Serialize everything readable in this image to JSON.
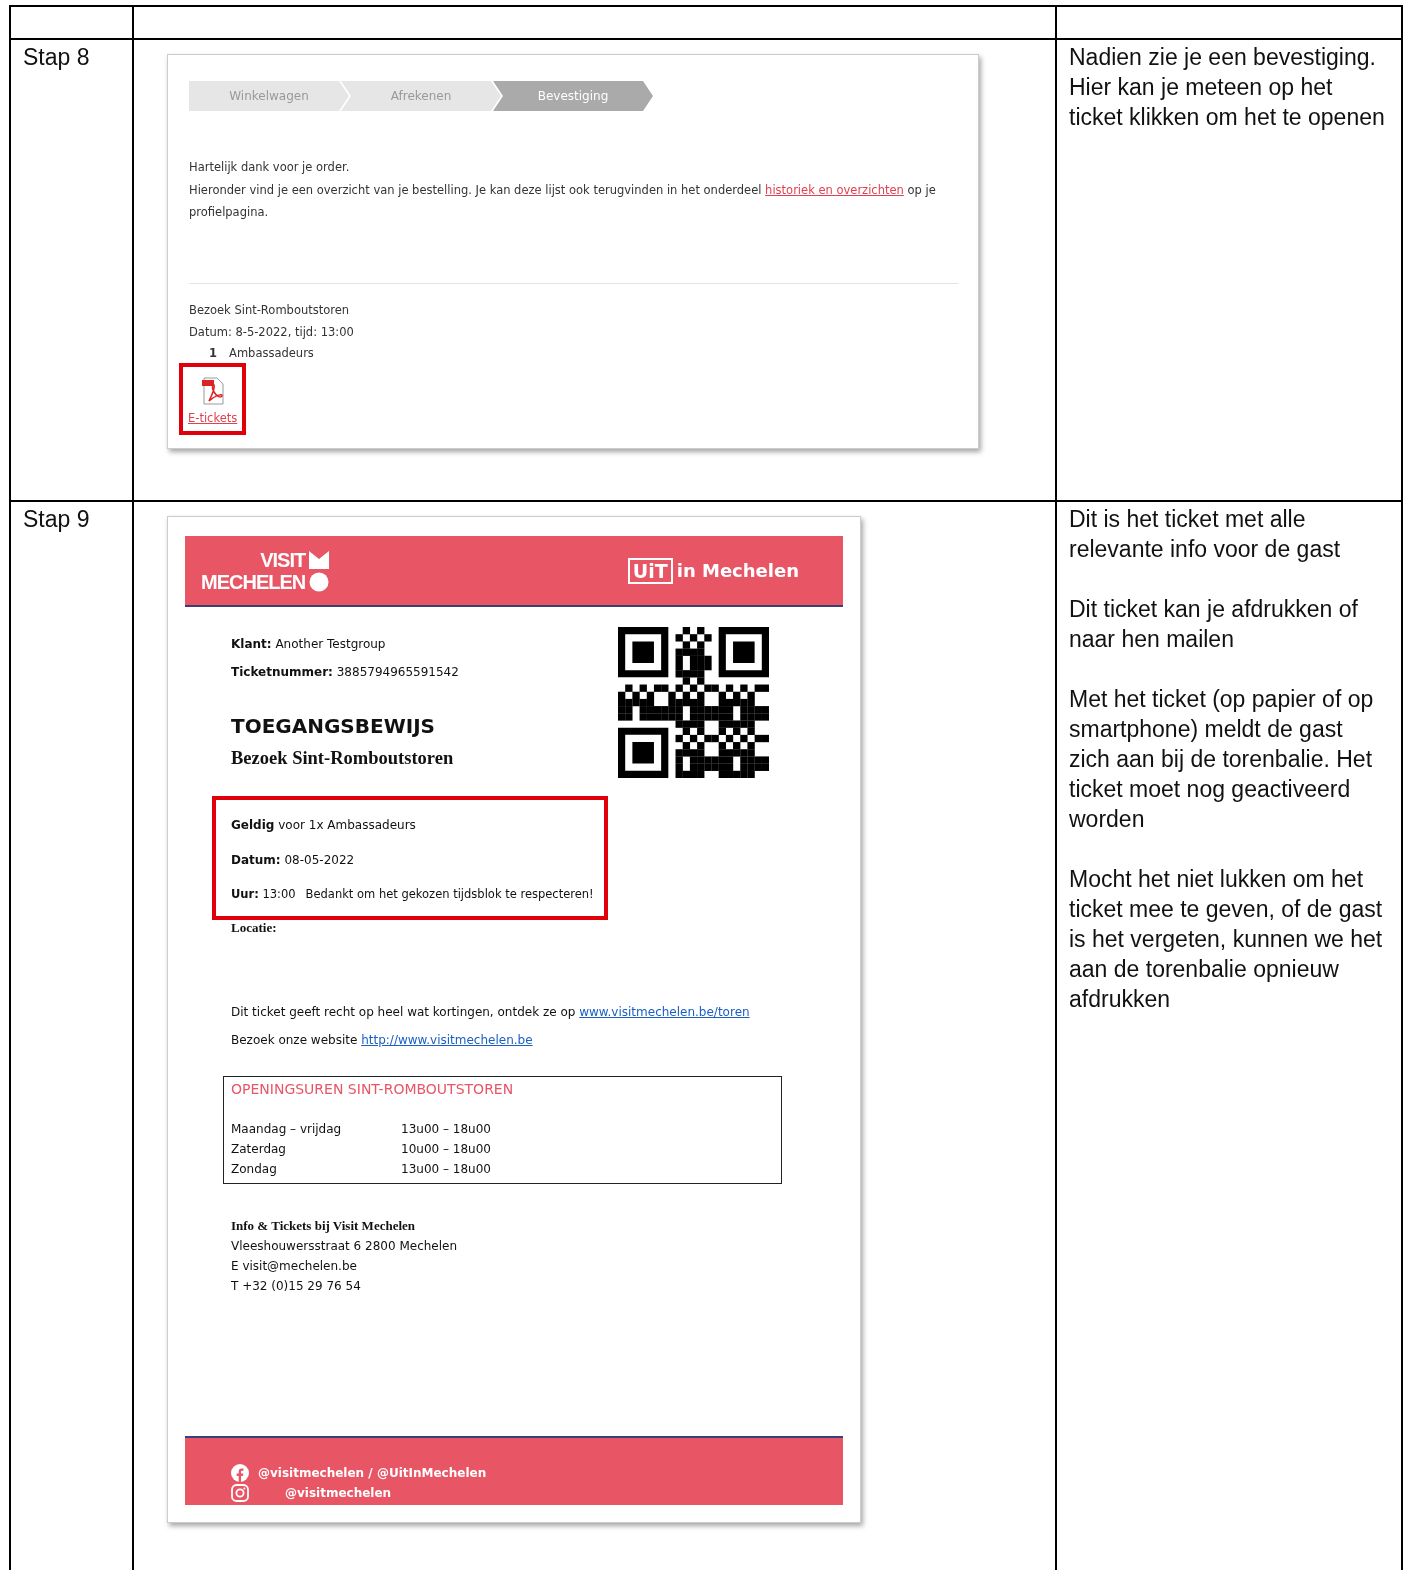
{
  "steps": [
    {
      "label": "Stap 8",
      "kind": "confirmation",
      "notes": [
        "Nadien zie je een bevestiging. Hier kan je meteen op het ticket klikken om het te openen"
      ]
    },
    {
      "label": "Stap 9",
      "kind": "ticket",
      "notes": [
        "Dit is het ticket met alle relevante info voor de gast",
        "Dit ticket kan je afdrukken of naar hen mailen",
        "Met het ticket (op papier of op smartphone) meldt de gast zich aan bij de torenbalie. Het ticket moet nog geactiveerd worden",
        "Mocht het niet lukken om het ticket mee te geven, of de gast is het vergeten, kunnen we het aan de torenbalie opnieuw afdrukken"
      ]
    }
  ],
  "confirmation": {
    "breadcrumbs": [
      {
        "label": "Winkelwagen",
        "selected": false
      },
      {
        "label": "Afrekenen",
        "selected": false
      },
      {
        "label": "Bevestiging",
        "selected": true
      }
    ],
    "thanks": "Hartelijk dank voor je order.",
    "intro_before": "Hieronder vind je een overzicht van je bestelling. Je kan deze lijst ook terugvinden in het onderdeel ",
    "intro_link": "historiek en overzichten",
    "intro_after": " op je profielpagina.",
    "order_title": "Bezoek Sint-Romboutstoren",
    "order_date": "Datum: 8-5-2022, tijd: 13:00",
    "quantity": "1",
    "ticket_type": "Ambassadeurs",
    "download": {
      "label": "E-tickets",
      "highlighted": true
    }
  },
  "ticket": {
    "logo_left": [
      "VISIT",
      "MECHELEN"
    ],
    "logo_right": {
      "badge": "UiT",
      "text": "in Mechelen"
    },
    "customer": "**Klant:**  Another Testgroup",
    "ticket_number": "**Ticketnummer:** 3885794965591542",
    "heading": "TOEGANGSBEWIJS",
    "subtitle": "Bezoek Sint-Romboutstoren",
    "details": {
      "highlighted": true,
      "valid": "**Geldig** voor 1x Ambassadeurs",
      "date": "**Datum:** 08-05-2022",
      "time": "**Uur:** 13:00",
      "thanks": "Bedankt om het gekozen tijdsblok te respecteren!"
    },
    "location": "Locatie:",
    "discount_text": "Dit ticket geeft recht op heel wat kortingen, ontdek ze op ",
    "discount_link": "www.visitmechelen.be/toren",
    "website_text": "Bezoek onze website ",
    "website_link": "http://www.visitmechelen.be",
    "hours": {
      "title": "OPENINGSUREN SINT-ROMBOUTSTOREN",
      "rows": [
        {
          "days": "Maandag – vrijdag",
          "time": "13u00 – 18u00"
        },
        {
          "days": "Zaterdag",
          "time": "10u00 – 18u00"
        },
        {
          "days": "Zondag",
          "time": "13u00 – 18u00"
        }
      ]
    },
    "info_title": "Info & Tickets bij Visit Mechelen",
    "info_lines": [
      "Vleeshouwersstraat 6 2800 Mechelen",
      "E visit@mechelen.be",
      "T +32 (0)15 29 76 54"
    ],
    "socials": [
      {
        "kind": "facebook",
        "text": "@visitmechelen / @UitInMechelen"
      },
      {
        "kind": "instagram",
        "text": "@visitmechelen"
      }
    ]
  }
}
